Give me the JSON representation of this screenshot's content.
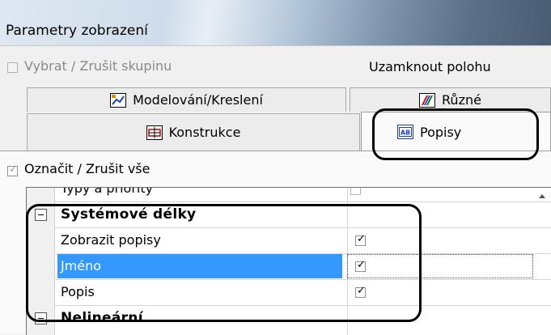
{
  "window": {
    "title": "Parametry zobrazení"
  },
  "group_row": {
    "select_group_label": "Vybrat / Zrušit skupinu",
    "lock_position_label": "Uzamknout polohu"
  },
  "tabs": [
    {
      "label": "Modelování/Kreslení",
      "icon": "modeling-icon"
    },
    {
      "label": "Různé",
      "icon": "misc-icon"
    },
    {
      "label": "Konstrukce",
      "icon": "construction-icon"
    },
    {
      "label": "Popisy",
      "icon": "labels-icon",
      "active": true
    }
  ],
  "select_all_label": "Označit / Zrušit vše",
  "grid": {
    "rows": [
      {
        "name": "Typy a priority",
        "checked": false,
        "type": "item"
      },
      {
        "name": "Systémové délky",
        "type": "category",
        "expanded": true
      },
      {
        "name": "Zobrazit popisy",
        "checked": true,
        "type": "item"
      },
      {
        "name": "Jméno",
        "checked": true,
        "type": "item",
        "selected": true
      },
      {
        "name": "Popis",
        "checked": true,
        "type": "item"
      },
      {
        "name": "Nelineární",
        "type": "category"
      }
    ]
  },
  "colors": {
    "selection": "#3399ff",
    "window_bg": "#f0f0f0"
  }
}
